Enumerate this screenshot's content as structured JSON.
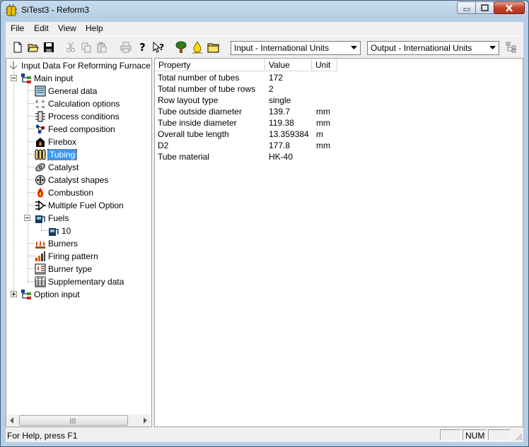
{
  "window": {
    "title": "SiTest3 - Reform3"
  },
  "menu": [
    {
      "label": "File"
    },
    {
      "label": "Edit"
    },
    {
      "label": "View"
    },
    {
      "label": "Help"
    }
  ],
  "toolbar": {
    "buttons": [
      "new-document",
      "open-folder",
      "save-disk",
      "cut-scissors",
      "copy",
      "paste",
      "print",
      "help-question",
      "context-help",
      "tree",
      "fuel-drop",
      "folder-open"
    ],
    "input_units": "Input - International Units",
    "output_units": "Output - International Units"
  },
  "tree": {
    "root": "Input Data For Reforming Furnace",
    "main_input": "Main input",
    "items": [
      {
        "label": "General data",
        "icon": "general-data-icon"
      },
      {
        "label": "Calculation options",
        "icon": "calculation-options-icon"
      },
      {
        "label": "Process conditions",
        "icon": "process-conditions-icon"
      },
      {
        "label": "Feed composition",
        "icon": "feed-composition-icon"
      },
      {
        "label": "Firebox",
        "icon": "firebox-icon"
      },
      {
        "label": "Tubing",
        "icon": "tubing-icon",
        "selected": true
      },
      {
        "label": "Catalyst",
        "icon": "catalyst-icon"
      },
      {
        "label": "Catalyst shapes",
        "icon": "catalyst-shapes-icon"
      },
      {
        "label": "Combustion",
        "icon": "combustion-icon"
      },
      {
        "label": "Multiple Fuel Option",
        "icon": "multiple-fuel-icon"
      },
      {
        "label": "Fuels",
        "icon": "fuels-icon"
      },
      {
        "label": "10",
        "icon": "fuel-item-icon"
      },
      {
        "label": "Burners",
        "icon": "burners-icon"
      },
      {
        "label": "Firing pattern",
        "icon": "firing-pattern-icon"
      },
      {
        "label": "Burner type",
        "icon": "burner-type-icon"
      },
      {
        "label": "Supplementary data",
        "icon": "supplementary-data-icon"
      }
    ],
    "option_input": "Option input"
  },
  "grid": {
    "columns": [
      "Property",
      "Value",
      "Unit"
    ],
    "rows": [
      {
        "property": "Total number of tubes",
        "value": "172",
        "unit": ""
      },
      {
        "property": "Total number of tube rows",
        "value": "2",
        "unit": ""
      },
      {
        "property": "Row layout type",
        "value": "single",
        "unit": ""
      },
      {
        "property": "Tube outside diameter",
        "value": "139.7",
        "unit": "mm"
      },
      {
        "property": "Tube inside diameter",
        "value": "119.38",
        "unit": "mm"
      },
      {
        "property": "Overall tube length",
        "value": "13.359384",
        "unit": "m"
      },
      {
        "property": "D2",
        "value": "177.8",
        "unit": "mm"
      },
      {
        "property": "Tube material",
        "value": "HK-40",
        "unit": ""
      }
    ]
  },
  "status": {
    "help_text": "For Help, press F1",
    "num": "NUM"
  }
}
